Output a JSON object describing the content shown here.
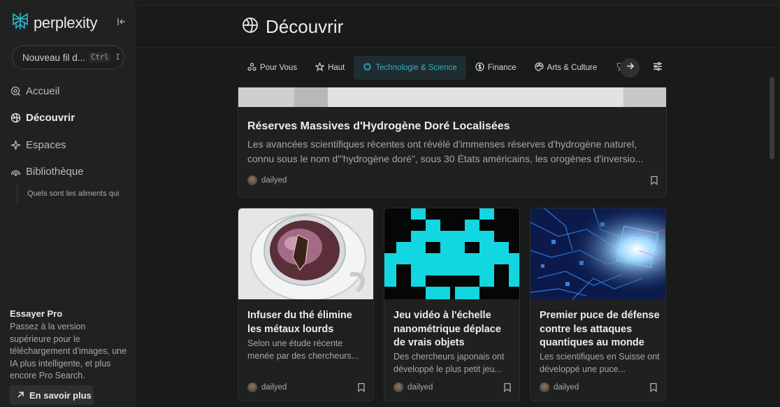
{
  "app": {
    "name": "perplexity"
  },
  "sidebar": {
    "new_thread_label": "Nouveau fil d...",
    "new_thread_kbd_1": "Ctrl",
    "new_thread_kbd_2": "I",
    "nav": [
      {
        "label": "Accueil",
        "icon": "home-search-icon"
      },
      {
        "label": "Découvrir",
        "icon": "globe-icon"
      },
      {
        "label": "Espaces",
        "icon": "sparkle-icon"
      },
      {
        "label": "Bibliothèque",
        "icon": "library-icon"
      }
    ],
    "library_threads": [
      "Quels sont les aliments qui"
    ],
    "pro": {
      "title": "Essayer Pro",
      "description": "Passez à la version supérieure pour le téléchargement d'images, une IA plus intelligente, et plus encore Pro Search.",
      "button_label": "En savoir plus"
    }
  },
  "page": {
    "title": "Découvrir"
  },
  "tabs": [
    {
      "label": "Pour Vous",
      "icon": "people-icon"
    },
    {
      "label": "Haut",
      "icon": "star-icon"
    },
    {
      "label": "Technologie & Science",
      "icon": "chip-icon",
      "active": true
    },
    {
      "label": "Finance",
      "icon": "dollar-icon"
    },
    {
      "label": "Arts & Culture",
      "icon": "palette-icon"
    },
    {
      "label": "",
      "icon": "trophy-icon"
    }
  ],
  "featured": {
    "title": "Réserves Massives d'Hydrogène Doré Localisées",
    "description": "Les avancées scientifiques récentes ont révélé d'immenses réserves d'hydrogène naturel, connu sous le nom d'\"hydrogène doré\", sous 30 États américains, les orogènes d'inversio...",
    "source": "dailyed"
  },
  "cards": [
    {
      "title": "Infuser du thé élimine les métaux lourds",
      "description": "Selon une étude récente menée par des chercheurs...",
      "source": "dailyed",
      "image": "tea-cup"
    },
    {
      "title": "Jeu vidéo à l'échelle nanométrique déplace de vrais objets",
      "description": "Des chercheurs japonais ont développé le plus petit jeu...",
      "source": "dailyed",
      "image": "space-invader"
    },
    {
      "title": "Premier puce de défense contre les attaques quantiques au monde",
      "description": "Les scientifiques en Suisse ont développé une puce...",
      "source": "dailyed",
      "image": "circuit-chip"
    }
  ],
  "colors": {
    "accent": "#2bb3c6",
    "sidebar_bg": "#202222",
    "main_bg": "#191a1a"
  }
}
